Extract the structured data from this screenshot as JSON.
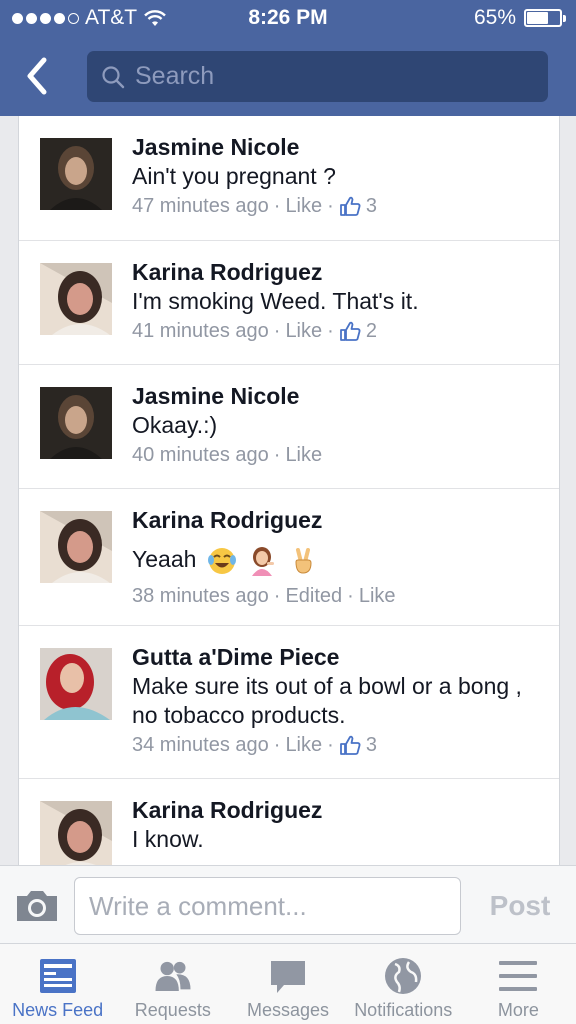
{
  "status_bar": {
    "carrier": "AT&T",
    "time": "8:26 PM",
    "battery_text": "65%",
    "battery_level": 0.65,
    "signal_bars_filled": 4,
    "signal_bars_total": 5
  },
  "header": {
    "back_icon": "chevron-left-icon",
    "search_placeholder": "Search",
    "search_icon": "search-icon"
  },
  "comments": [
    {
      "name": "Jasmine Nicole",
      "text": "Ain't you pregnant ?",
      "time": "47 minutes ago",
      "edited": "",
      "like_label": "Like",
      "likes": "3"
    },
    {
      "name": "Karina Rodriguez",
      "text": "I'm smoking Weed. That's it.",
      "time": "41 minutes ago",
      "edited": "",
      "like_label": "Like",
      "likes": "2"
    },
    {
      "name": "Jasmine Nicole",
      "text": "Okaay.:)",
      "time": "40 minutes ago",
      "edited": "",
      "like_label": "Like",
      "likes": ""
    },
    {
      "name": "Karina Rodriguez",
      "text": "Yeaah",
      "emojis": [
        "tears-of-joy-emoji",
        "information-desk-person-emoji",
        "victory-hand-emoji"
      ],
      "time": "38 minutes ago",
      "edited": "Edited",
      "like_label": "Like",
      "likes": ""
    },
    {
      "name": "Gutta a'Dime Piece",
      "text": "Make sure its out of a bowl or a bong , no tobacco products.",
      "time": "34 minutes ago",
      "edited": "",
      "like_label": "Like",
      "likes": "3"
    },
    {
      "name": "Karina Rodriguez",
      "text": "I know.",
      "time": "",
      "edited": "",
      "like_label": "",
      "likes": ""
    }
  ],
  "composer": {
    "camera_icon": "camera-icon",
    "placeholder": "Write a comment...",
    "post_label": "Post"
  },
  "tabbar": [
    {
      "label": "News Feed",
      "icon": "news-feed-icon",
      "active": true
    },
    {
      "label": "Requests",
      "icon": "friend-requests-icon",
      "active": false
    },
    {
      "label": "Messages",
      "icon": "messages-icon",
      "active": false
    },
    {
      "label": "Notifications",
      "icon": "globe-icon",
      "active": false
    },
    {
      "label": "More",
      "icon": "menu-icon",
      "active": false
    }
  ],
  "colors": {
    "header_bg": "#4a65a0",
    "link_blue": "#4a73c6",
    "meta_gray": "#9197a3"
  }
}
